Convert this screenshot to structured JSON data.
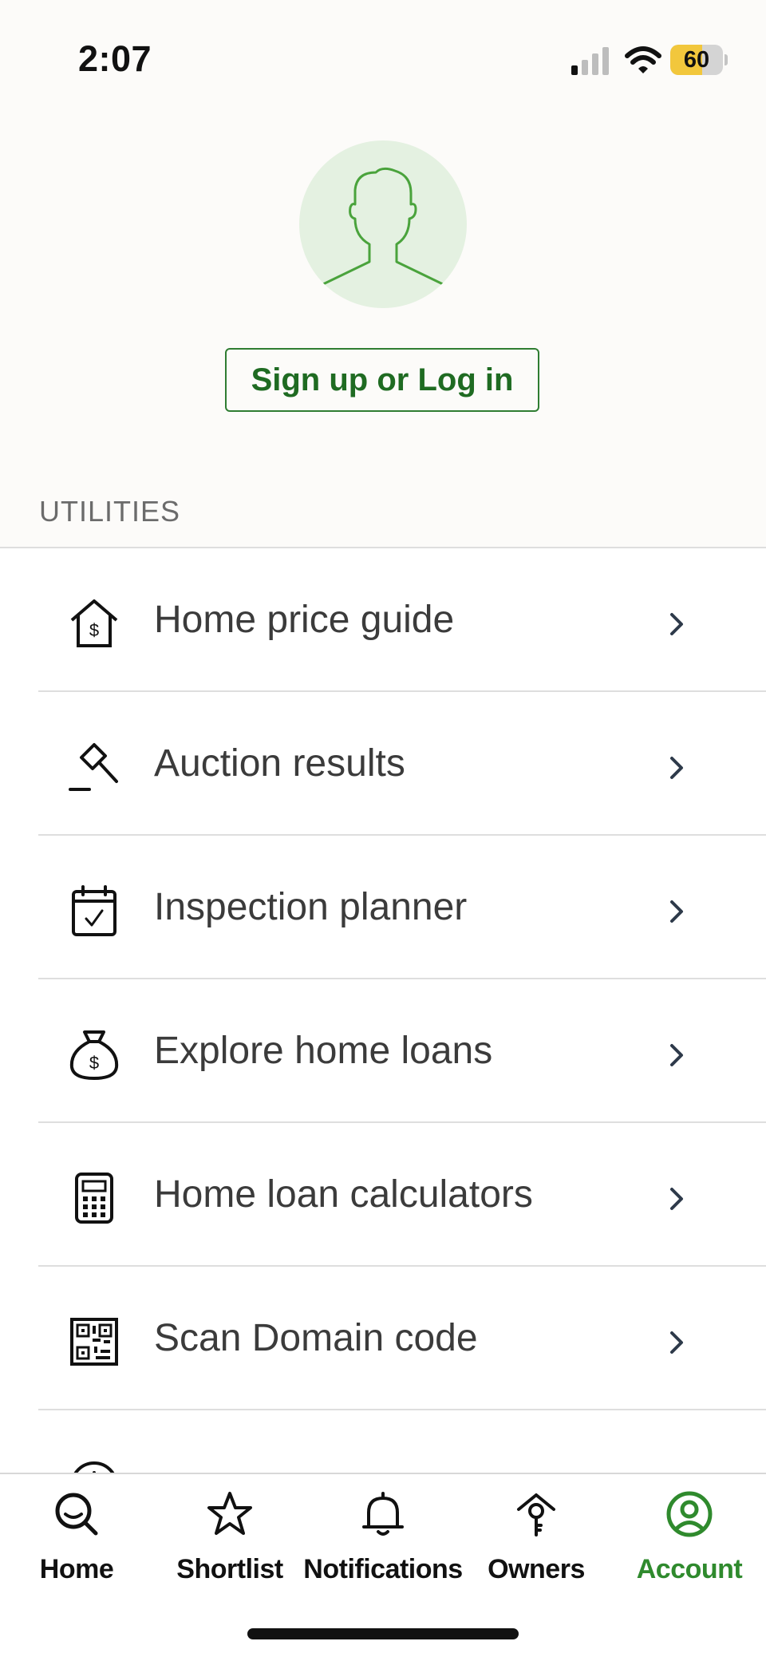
{
  "status_bar": {
    "time": "2:07",
    "battery": "60",
    "battery_level": 0.6,
    "battery_color": "#f2c73c"
  },
  "profile": {
    "signup_label": "Sign up or Log in"
  },
  "utilities": {
    "title": "UTILITIES",
    "items": [
      {
        "label": "Home price guide",
        "icon": "house-dollar-icon"
      },
      {
        "label": "Auction results",
        "icon": "gavel-icon"
      },
      {
        "label": "Inspection planner",
        "icon": "calendar-check-icon"
      },
      {
        "label": "Explore home loans",
        "icon": "money-bag-icon"
      },
      {
        "label": "Home loan calculators",
        "icon": "calculator-icon"
      },
      {
        "label": "Scan Domain code",
        "icon": "qr-code-icon"
      }
    ]
  },
  "tab_bar": {
    "tabs": [
      {
        "label": "Home",
        "icon": "search-home-icon",
        "active": false
      },
      {
        "label": "Shortlist",
        "icon": "star-icon",
        "active": false
      },
      {
        "label": "Notifications",
        "icon": "bell-icon",
        "active": false
      },
      {
        "label": "Owners",
        "icon": "house-key-icon",
        "active": false
      },
      {
        "label": "Account",
        "icon": "account-circle-icon",
        "active": true
      }
    ]
  },
  "colors": {
    "brand_green": "#2f7d32",
    "active_tab": "#2f8a2d",
    "background": "#fcfbf9"
  }
}
